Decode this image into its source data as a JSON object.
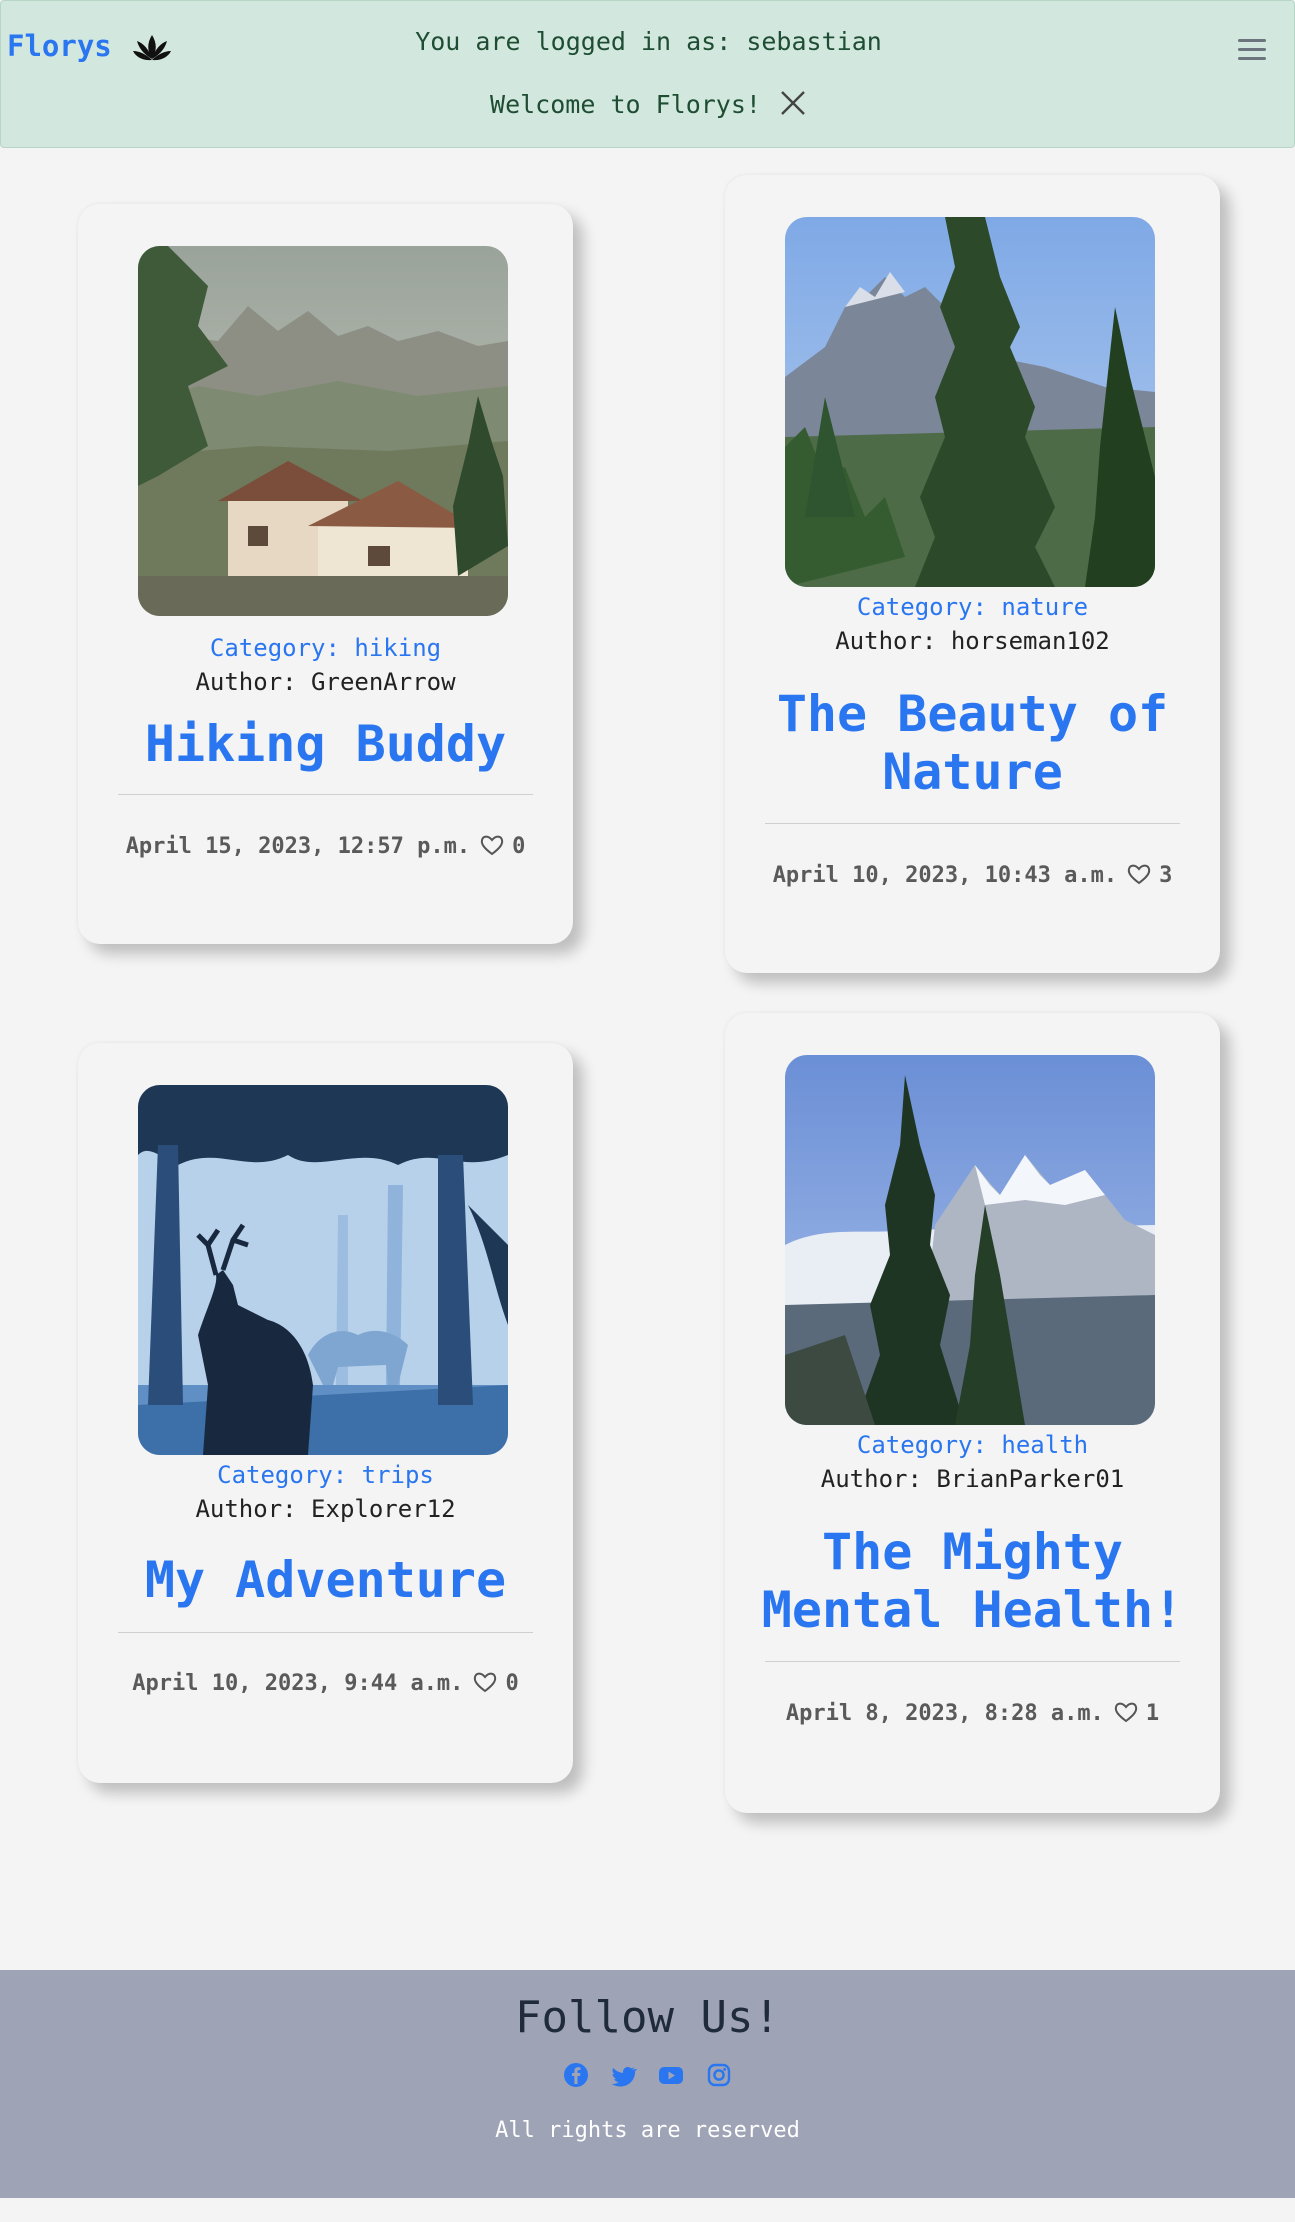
{
  "header": {
    "brand": "Florys",
    "logged_in_text": "You are logged in as: sebastian",
    "welcome_text": "Welcome to Florys!",
    "brand_color": "#2a76f0",
    "alert_bg": "#d2e8de"
  },
  "posts": [
    {
      "category": "Category: hiking",
      "author": "Author: GreenArrow",
      "title": "Hiking Buddy",
      "date": "April 15, 2023, 12:57 p.m.",
      "likes": "0",
      "image": "mountain-houses-photo"
    },
    {
      "category": "Category: nature",
      "author": "Author: horseman102",
      "title": "The Beauty of Nature",
      "date": "April 10, 2023, 10:43 a.m.",
      "likes": "3",
      "image": "mountain-pines-photo"
    },
    {
      "category": "Category: trips",
      "author": "Author: Explorer12",
      "title": "My Adventure",
      "date": "April 10, 2023, 9:44 a.m.",
      "likes": "0",
      "image": "deer-forest-illustration"
    },
    {
      "category": "Category: health",
      "author": "Author: BrianParker01",
      "title": "The Mighty Mental Health!",
      "date": "April 8, 2023, 8:28 a.m.",
      "likes": "1",
      "image": "snowy-peaks-photo"
    }
  ],
  "footer": {
    "follow_text": "Follow Us!",
    "socials": [
      "facebook-icon",
      "twitter-icon",
      "youtube-icon",
      "instagram-icon"
    ],
    "rights_text": "All rights are reserved",
    "bg": "#9ea3b5"
  }
}
